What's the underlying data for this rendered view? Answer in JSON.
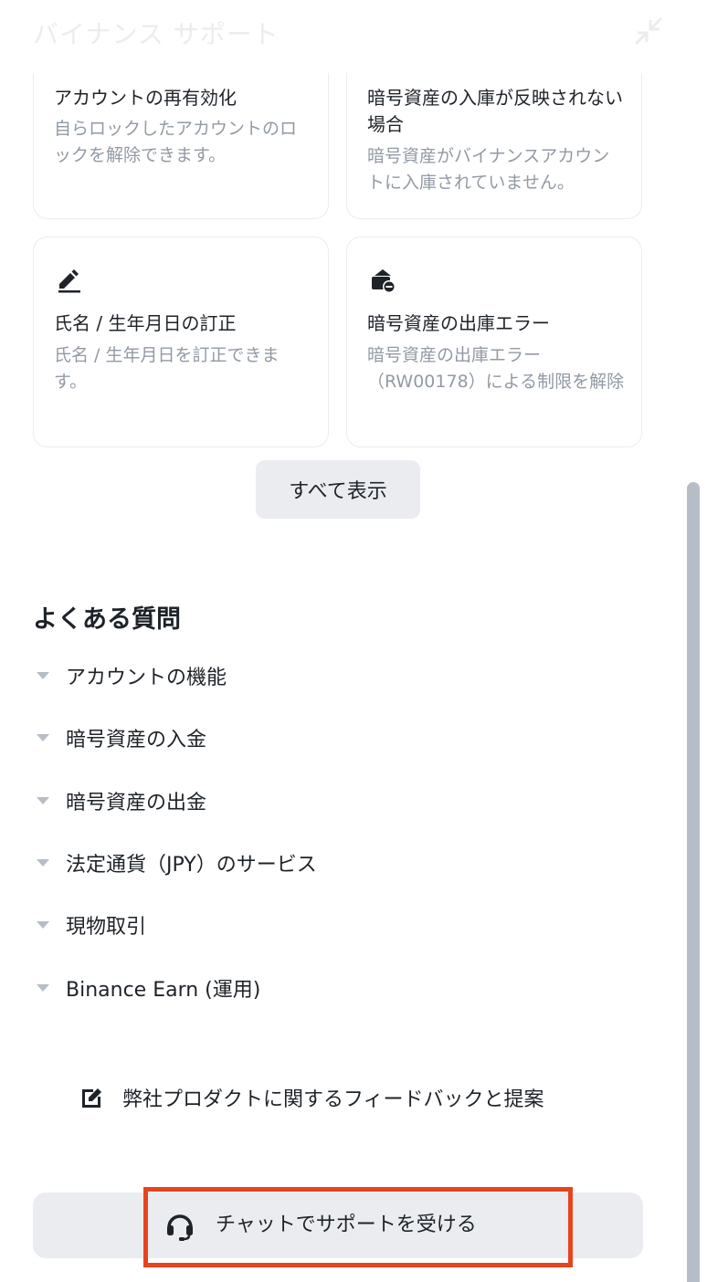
{
  "header": {
    "title": "バイナンス サポート"
  },
  "cards": [
    {
      "title": "アカウントの再有効化",
      "desc": "自らロックしたアカウントのロックを解除できます。"
    },
    {
      "title": "暗号資産の入庫が反映されない場合",
      "desc": "暗号資産がバイナンスアカウントに入庫されていません。"
    },
    {
      "icon": "pencil-icon",
      "title": "氏名 / 生年月日の訂正",
      "desc": "氏名 / 生年月日を訂正できます。"
    },
    {
      "icon": "wallet-minus-icon",
      "title": "暗号資産の出庫エラー",
      "desc": "暗号資産の出庫エラー（RW00178）による制限を解除"
    }
  ],
  "show_all_label": "すべて表示",
  "faq": {
    "heading": "よくある質問",
    "items": [
      {
        "label": "アカウントの機能"
      },
      {
        "label": "暗号資産の入金"
      },
      {
        "label": "暗号資産の出金"
      },
      {
        "label": "法定通貨（JPY）のサービス"
      },
      {
        "label": "現物取引"
      },
      {
        "label": "Binance Earn (運用)"
      }
    ]
  },
  "feedback": {
    "label": "弊社プロダクトに関するフィードバックと提案",
    "icon": "edit-icon"
  },
  "chat": {
    "label": "チャットでサポートを受ける",
    "icon": "headset-icon"
  },
  "colors": {
    "text": "#1e2329",
    "muted": "#929aa5",
    "border": "#eaecef",
    "button_bg": "#eaecef",
    "highlight": "#e8431f"
  }
}
